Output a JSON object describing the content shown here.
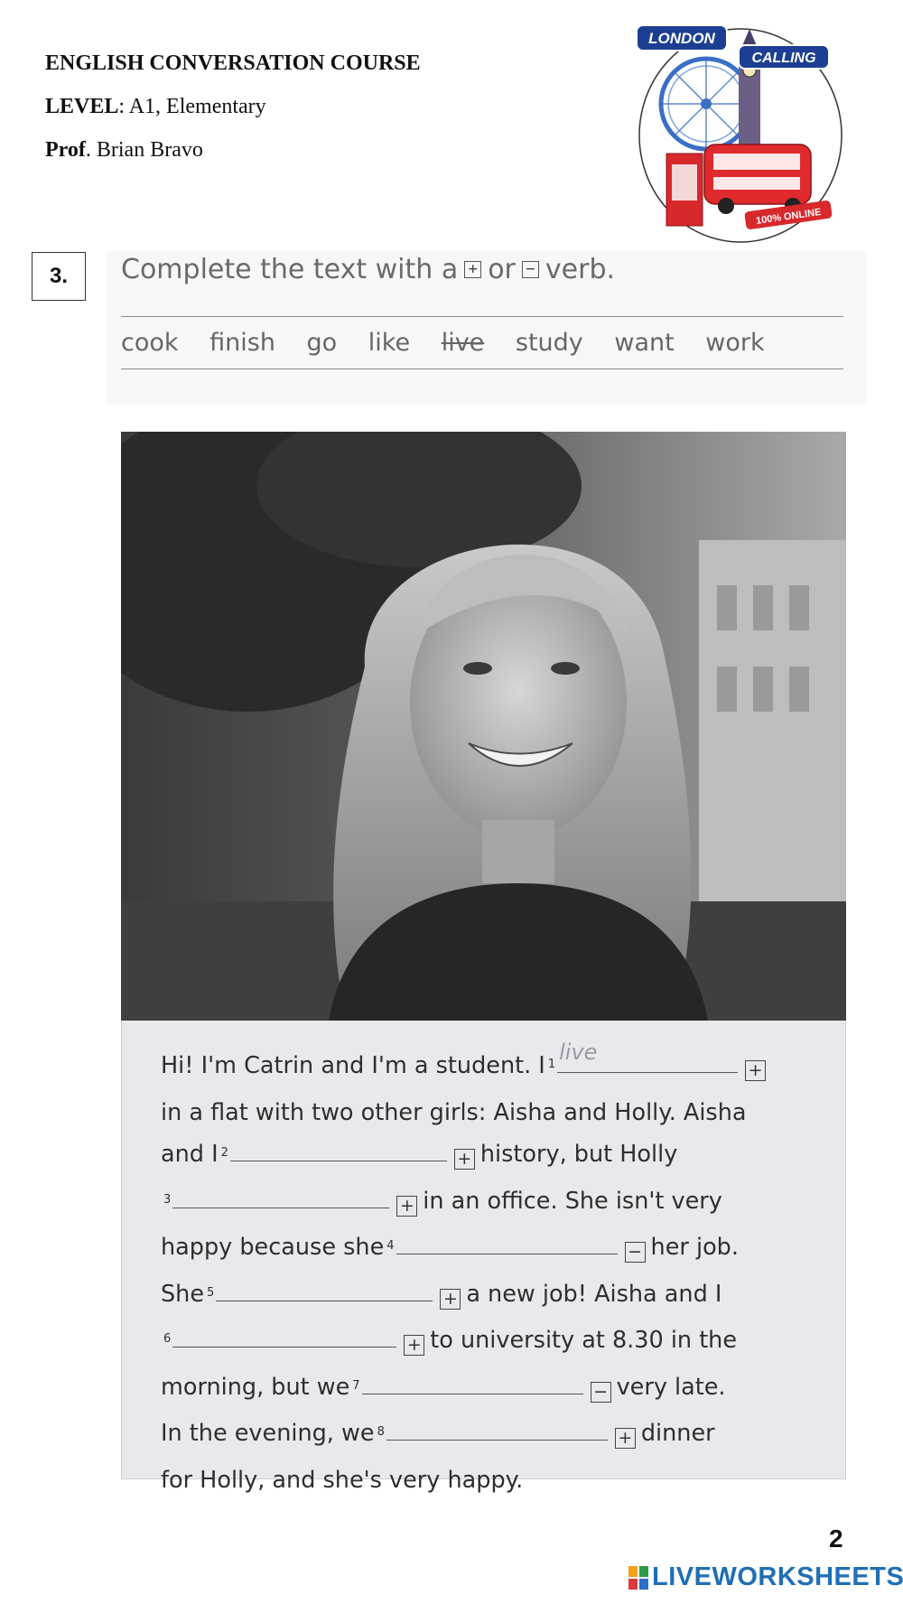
{
  "header": {
    "course": "ENGLISH CONVERSATION COURSE",
    "level_label": "LEVEL",
    "level_value": ": A1, Elementary",
    "prof_label": "Prof",
    "prof_value": ". Brian Bravo"
  },
  "logo": {
    "top_text": "LONDON",
    "right_text": "CALLING",
    "badge_text": "100% ONLINE",
    "icon": "london-calling-logo-icon"
  },
  "exercise": {
    "number": "3.",
    "instruction_pre": "Complete the text with a",
    "plus_symbol": "+",
    "instruction_mid": "or",
    "minus_symbol": "−",
    "instruction_post": "verb.",
    "word_box": [
      "cook",
      "finish",
      "go",
      "like",
      "live",
      "study",
      "want",
      "work"
    ],
    "struck_word": "live"
  },
  "photo": {
    "icon": "smiling-woman-photo"
  },
  "text": {
    "l1_pre": "Hi! I'm Catrin and I'm a student. I",
    "n1": "1",
    "a1": "live",
    "l2": "in a flat with two other girls: Aisha and Holly. Aisha",
    "l3_pre": "and I",
    "n2": "2",
    "l3_post": "history, but Holly",
    "n3": "3",
    "l4_post": "in an office. She isn't very",
    "l5_pre": "happy because she",
    "n4": "4",
    "l5_post": "her job.",
    "l6_pre": "She",
    "n5": "5",
    "l6_post": "a new job! Aisha and I",
    "n6": "6",
    "l7_post": "to university at 8.30 in the",
    "l8_pre": "morning, but we",
    "n7": "7",
    "l8_post": "very late.",
    "l9_pre": "In the evening, we",
    "n8": "8",
    "l9_post": "dinner",
    "l10": "for Holly, and she's very happy.",
    "plus": "+",
    "minus": "−"
  },
  "footer": {
    "page_number": "2",
    "brand": "LIVEWORKSHEETS",
    "brand_color": "#1f6fb5"
  }
}
